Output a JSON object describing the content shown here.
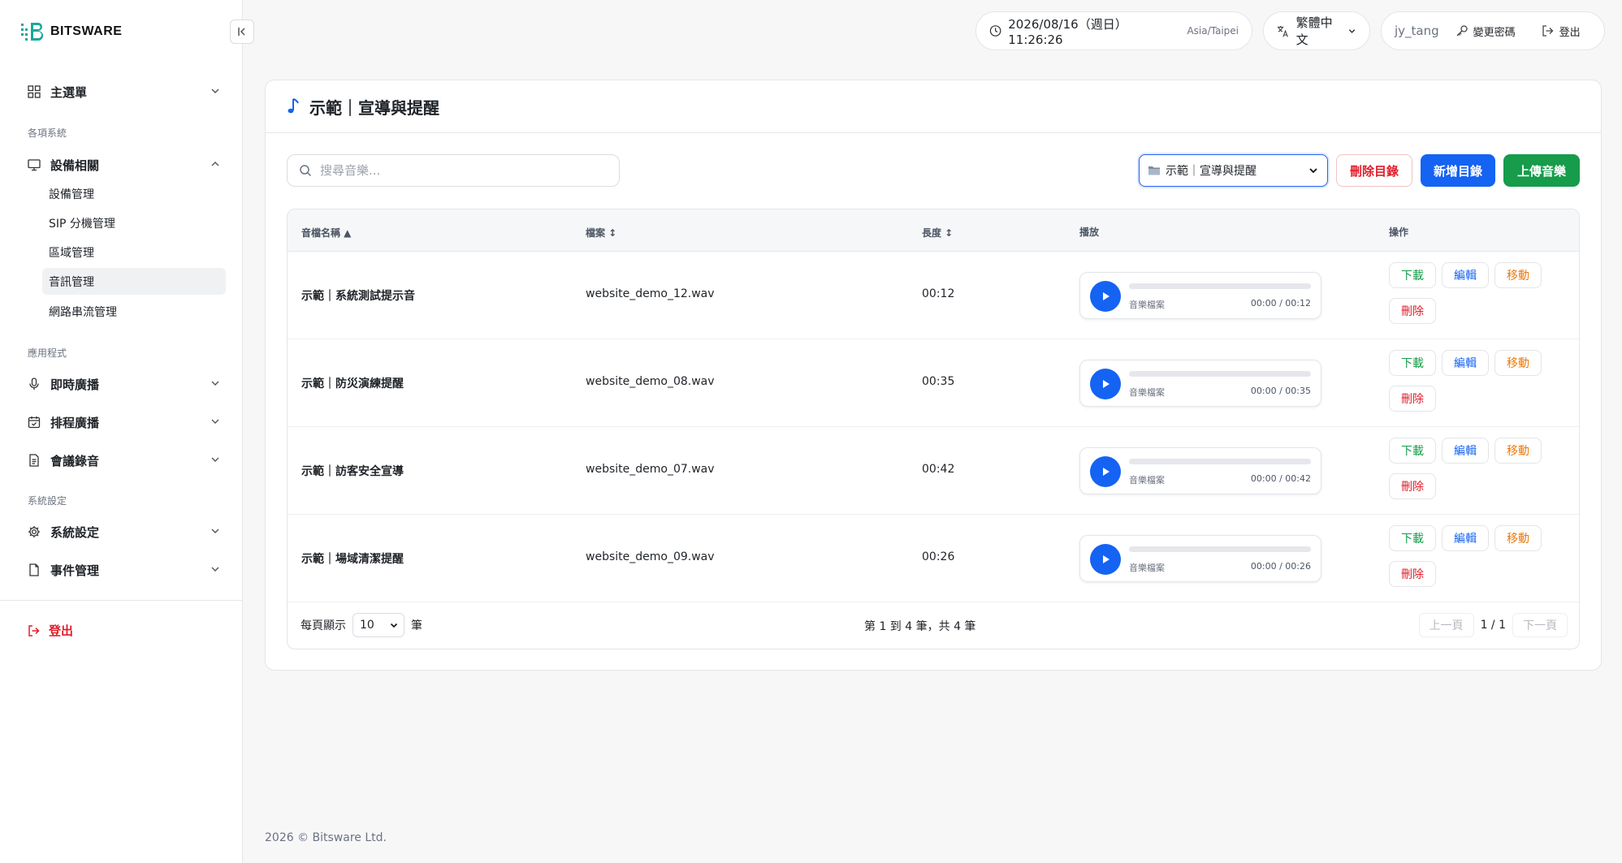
{
  "brand": {
    "name": "BITSWARE"
  },
  "sidebar": {
    "main_menu": "主選單",
    "section_systems": "各項系統",
    "device_group": "設備相關",
    "device_items": [
      "設備管理",
      "SIP 分機管理",
      "區域管理",
      "音訊管理",
      "網路串流管理"
    ],
    "section_apps": "應用程式",
    "apps": [
      "即時廣播",
      "排程廣播",
      "會議錄音"
    ],
    "section_settings": "系統設定",
    "settings": [
      "系統設定",
      "事件管理"
    ],
    "logout": "登出"
  },
  "topbar": {
    "datetime": "2026/08/16（週日） 11:26:26",
    "timezone": "Asia/Taipei",
    "language": "繁體中文",
    "username": "jy_tang",
    "change_password": "變更密碼",
    "logout": "登出"
  },
  "page": {
    "title": "示範｜宣導與提醒",
    "search_placeholder": "搜尋音樂...",
    "folder_selected": "示範｜宣導與提醒",
    "delete_dir": "刪除目錄",
    "new_dir": "新增目錄",
    "upload": "上傳音樂"
  },
  "table": {
    "headers": {
      "name": "音檔名稱 ▲",
      "file": "檔案 ↕",
      "length": "長度 ↕",
      "play": "播放",
      "actions": "操作"
    },
    "rows": [
      {
        "name": "示範｜系統測試提示音",
        "file": "website_demo_12.wav",
        "length": "00:12",
        "player_label": "音樂檔案",
        "player_time": "00:00 / 00:12",
        "progress": 0
      },
      {
        "name": "示範｜防災演練提醒",
        "file": "website_demo_08.wav",
        "length": "00:35",
        "player_label": "音樂檔案",
        "player_time": "00:00 / 00:35",
        "progress": 0
      },
      {
        "name": "示範｜訪客安全宣導",
        "file": "website_demo_07.wav",
        "length": "00:42",
        "player_label": "音樂檔案",
        "player_time": "00:00 / 00:42",
        "progress": 0
      },
      {
        "name": "示範｜場域清潔提醒",
        "file": "website_demo_09.wav",
        "length": "00:26",
        "player_label": "音樂檔案",
        "player_time": "00:00 / 00:26",
        "progress": 0
      }
    ],
    "actions": {
      "download": "下載",
      "edit": "編輯",
      "move": "移動",
      "delete": "刪除"
    },
    "footer": {
      "per_page_prefix": "每頁顯示",
      "per_page_value": "10",
      "per_page_suffix": "筆",
      "page_info": "第 1 到 4 筆，共 4 筆",
      "prev": "上一頁",
      "page": "1 / 1",
      "next": "下一頁"
    }
  },
  "footer": {
    "copyright": "2026 © Bitsware Ltd."
  },
  "colors": {
    "primary": "#1463f3",
    "success": "#169c4a",
    "danger": "#e11d2a",
    "warning": "#ea7a0e",
    "brand_teal": "#17a89a"
  }
}
